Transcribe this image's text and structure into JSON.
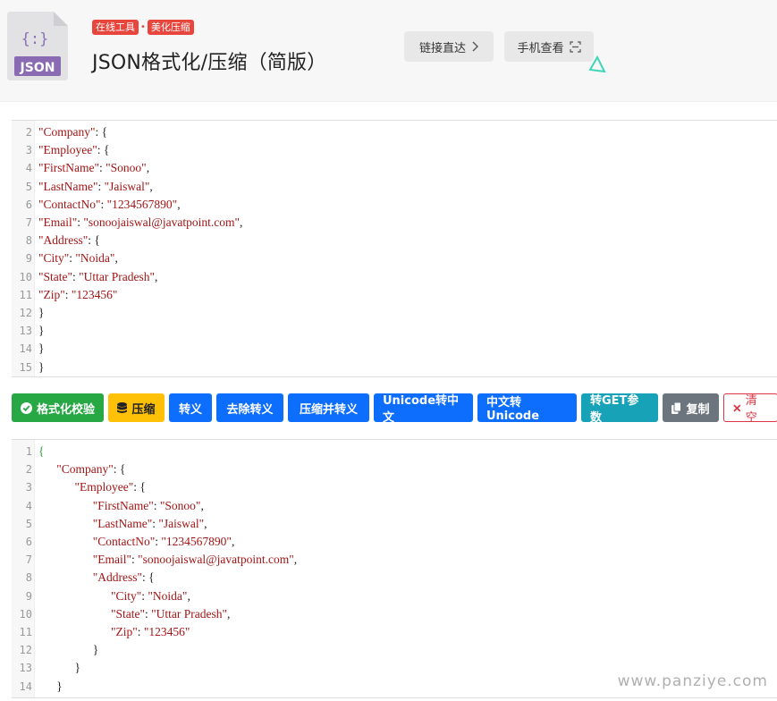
{
  "header": {
    "logo_text": "JSON",
    "logo_glyph": "{:}",
    "tags": [
      "在线工具",
      "美化压缩"
    ],
    "title": "JSON格式化/压缩（简版）",
    "link_button": "链接直达",
    "mobile_button": "手机查看"
  },
  "input_editor": {
    "lines": [
      {
        "n": "2",
        "t": "\"Company\": {"
      },
      {
        "n": "3",
        "t": "\"Employee\": {"
      },
      {
        "n": "4",
        "t": "\"FirstName\": \"Sonoo\","
      },
      {
        "n": "5",
        "t": "\"LastName\": \"Jaiswal\","
      },
      {
        "n": "6",
        "t": "\"ContactNo\": \"1234567890\","
      },
      {
        "n": "7",
        "t": "\"Email\": \"sonoojaiswal@javatpoint.com\","
      },
      {
        "n": "8",
        "t": "\"Address\": {"
      },
      {
        "n": "9",
        "t": "\"City\": \"Noida\","
      },
      {
        "n": "10",
        "t": "\"State\": \"Uttar Pradesh\","
      },
      {
        "n": "11",
        "t": "\"Zip\": \"123456\""
      },
      {
        "n": "12",
        "t": "}"
      },
      {
        "n": "13",
        "t": "}"
      },
      {
        "n": "14",
        "t": "}"
      },
      {
        "n": "15",
        "t": "}"
      }
    ]
  },
  "toolbar": {
    "validate": "格式化校验",
    "compress": "压缩",
    "escape": "转义",
    "unescape": "去除转义",
    "compress_escape": "压缩并转义",
    "unicode_to_cn": "Unicode转中文",
    "cn_to_unicode": "中文转Unicode",
    "to_get_params": "转GET参数",
    "copy": "复制",
    "clear": "清空"
  },
  "output_editor": {
    "lines": [
      {
        "n": "1",
        "t": "{"
      },
      {
        "n": "2",
        "t": "      \"Company\": {"
      },
      {
        "n": "3",
        "t": "            \"Employee\": {"
      },
      {
        "n": "4",
        "t": "                  \"FirstName\": \"Sonoo\","
      },
      {
        "n": "5",
        "t": "                  \"LastName\": \"Jaiswal\","
      },
      {
        "n": "6",
        "t": "                  \"ContactNo\": \"1234567890\","
      },
      {
        "n": "7",
        "t": "                  \"Email\": \"sonoojaiswal@javatpoint.com\","
      },
      {
        "n": "8",
        "t": "                  \"Address\": {"
      },
      {
        "n": "9",
        "t": "                        \"City\": \"Noida\","
      },
      {
        "n": "10",
        "t": "                        \"State\": \"Uttar Pradesh\","
      },
      {
        "n": "11",
        "t": "                        \"Zip\": \"123456\""
      },
      {
        "n": "12",
        "t": "                  }"
      },
      {
        "n": "13",
        "t": "            }"
      },
      {
        "n": "14",
        "t": "      }"
      }
    ]
  },
  "watermark": "www.panziye.com",
  "colors": {
    "tag": "#e8453c",
    "green": "#28a745",
    "yellow": "#ffc107",
    "blue": "#0d6efd",
    "teal": "#17a2b8",
    "gray": "#6c757d",
    "danger": "#dc3545"
  }
}
